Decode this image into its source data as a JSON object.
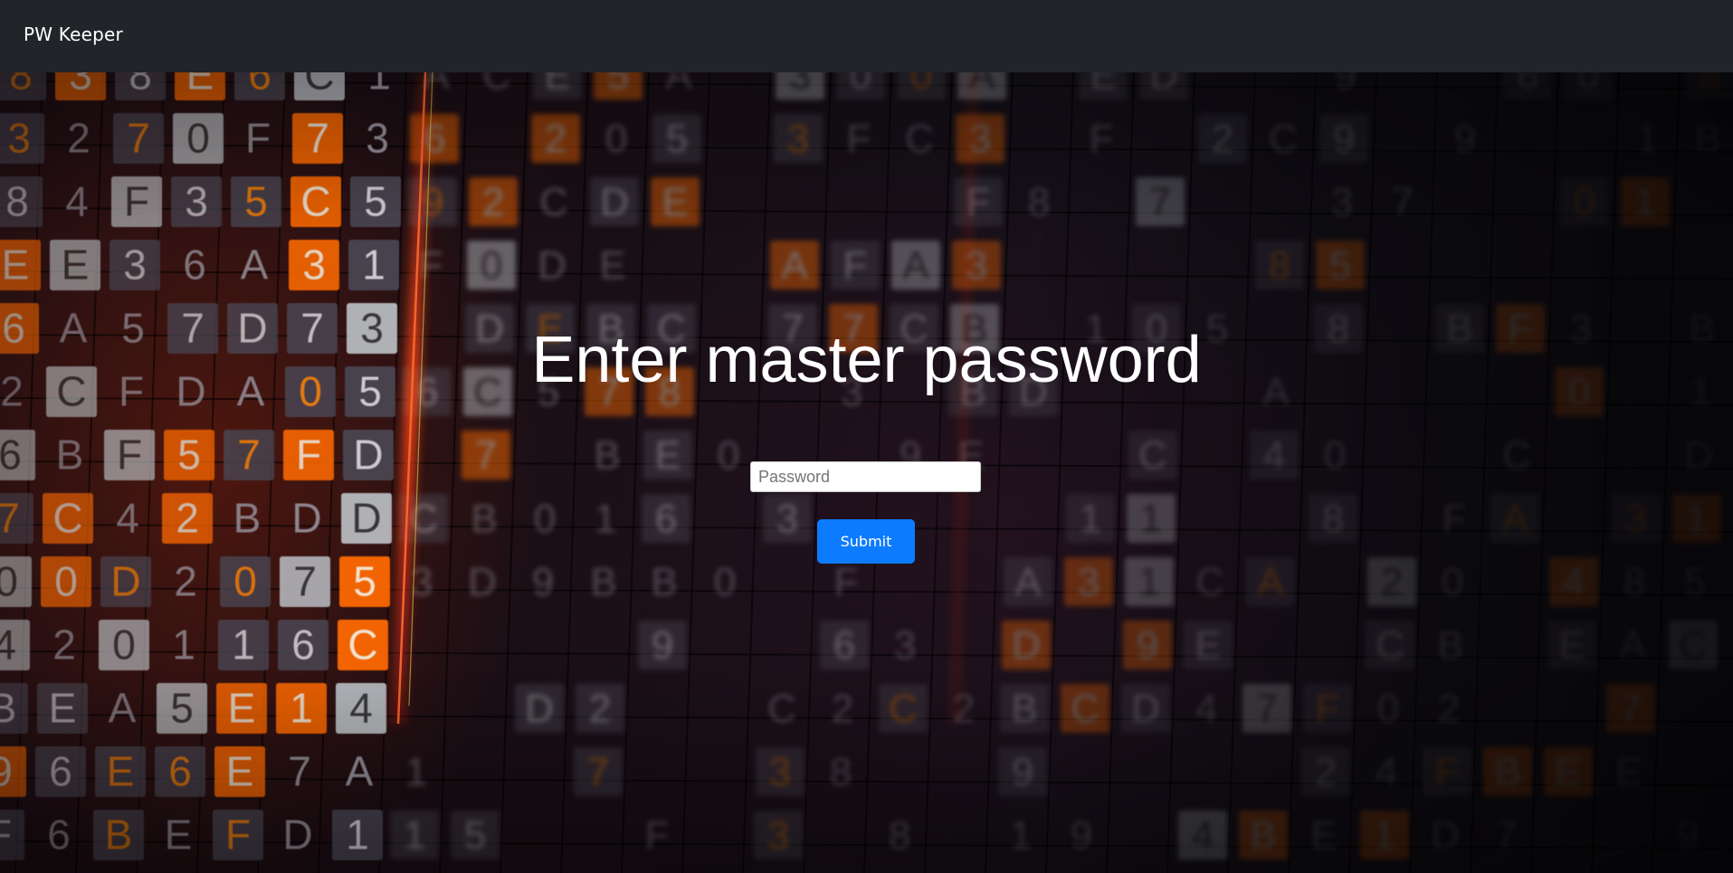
{
  "navbar": {
    "brand": "PW Keeper"
  },
  "main": {
    "title": "Enter master password",
    "password_placeholder": "Password",
    "password_value": "",
    "submit_label": "Submit"
  },
  "background": {
    "description_icon": "hex-code-matrix-background",
    "accent_colors": {
      "orange": "#ff7a00",
      "red_glow": "#ff2a10",
      "tile_gray": "#6a6670",
      "button_blue": "#0d7bfd",
      "navbar": "#212529"
    }
  }
}
